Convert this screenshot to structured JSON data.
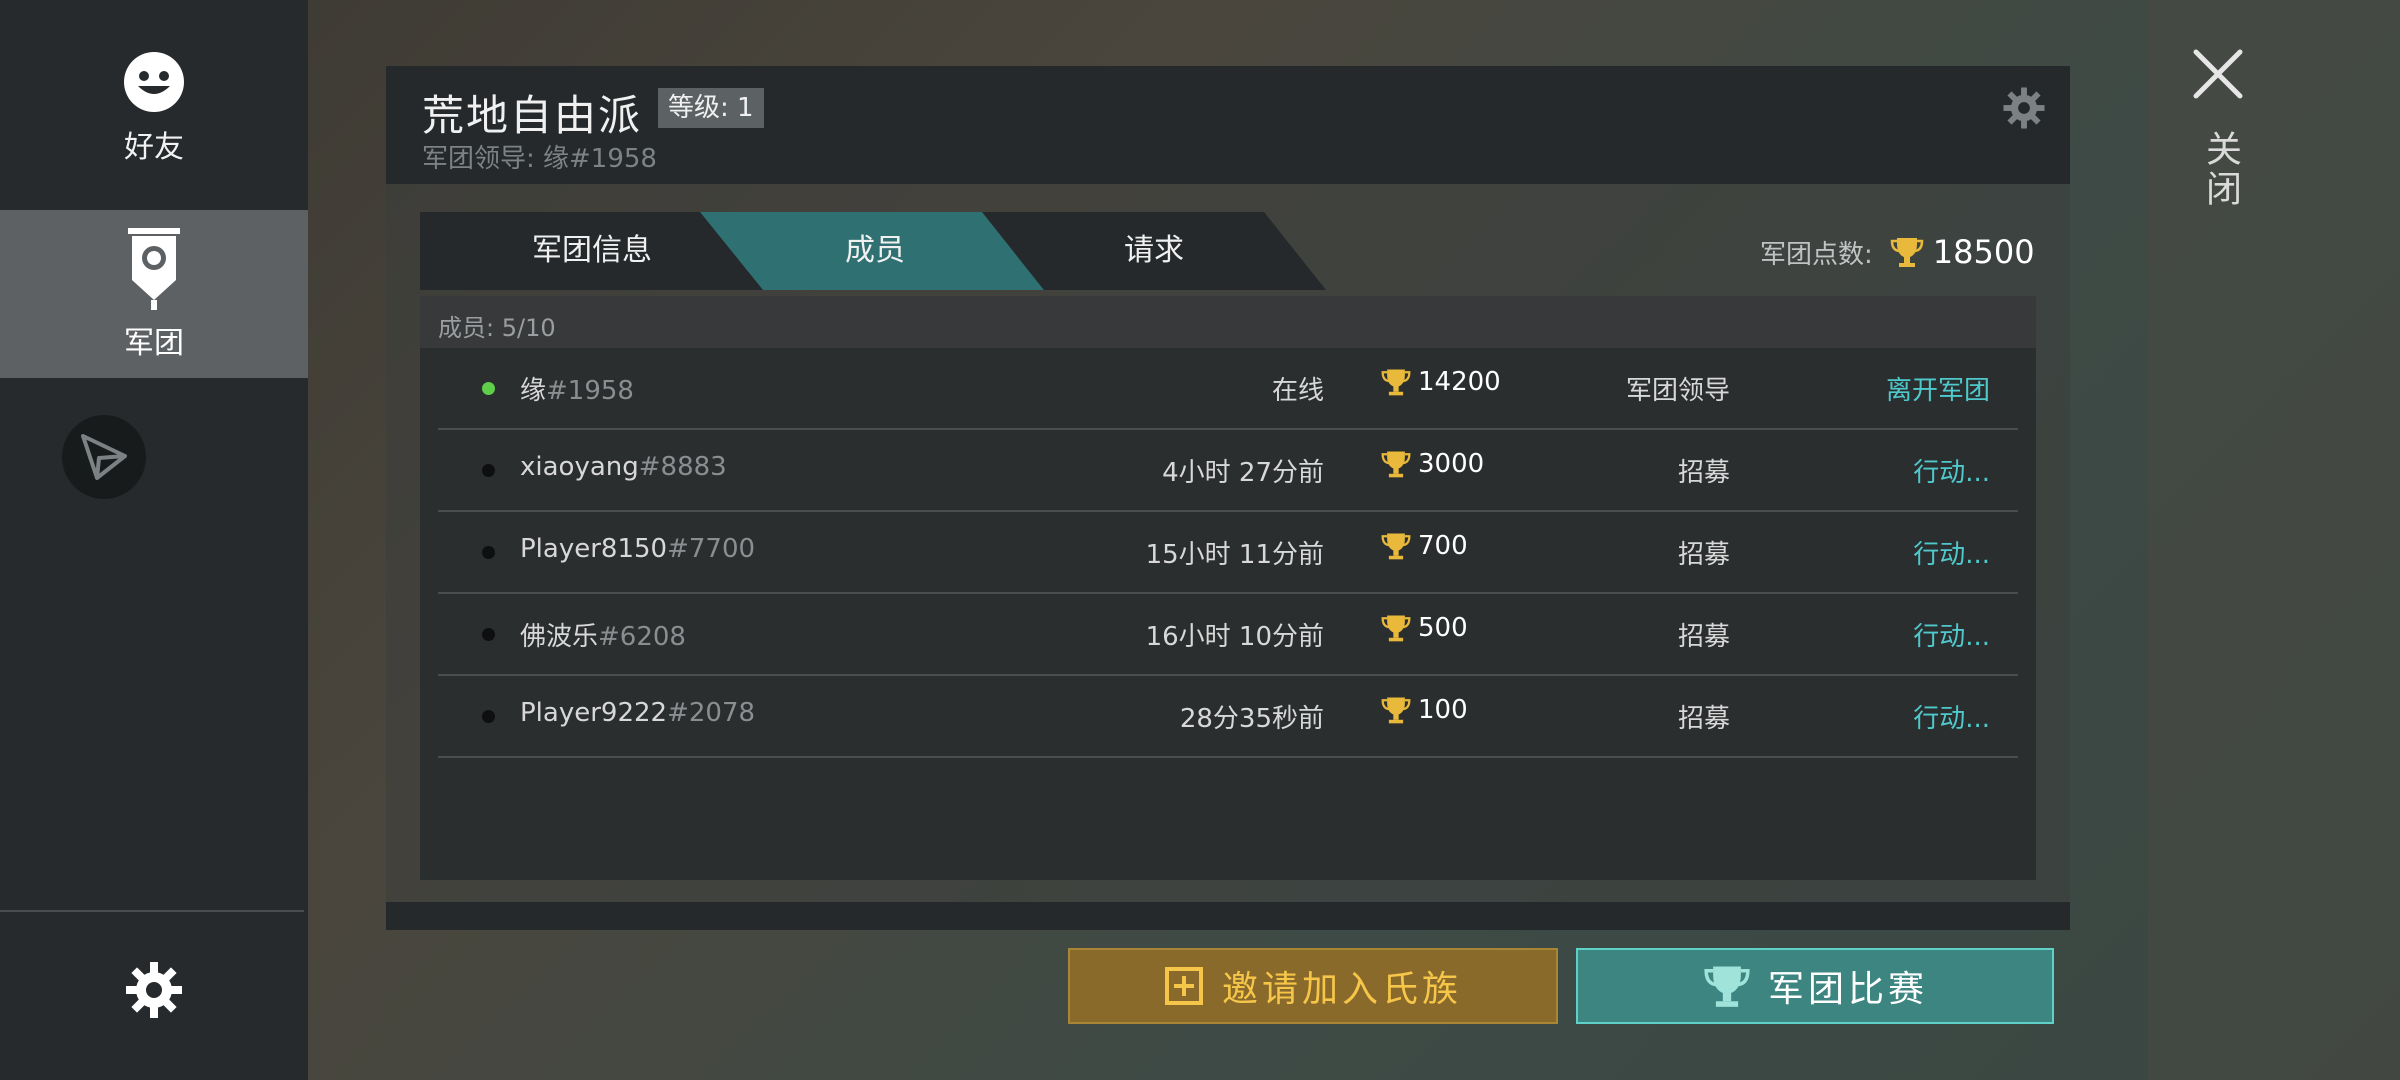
{
  "sidebar": {
    "friends_label": "好友",
    "legion_label": "军团"
  },
  "right": {
    "close_label": "关闭"
  },
  "guild": {
    "name": "荒地自由派",
    "level": "等级: 1",
    "leader_line": "军团领导: 缘#1958"
  },
  "tabs": [
    {
      "label": "军团信息"
    },
    {
      "label": "成员"
    },
    {
      "label": "请求"
    }
  ],
  "points": {
    "label": "军团点数:",
    "value": "18500"
  },
  "members": {
    "count_label": "成员: 5/10",
    "rows": [
      {
        "name": "缘",
        "tag": "#1958",
        "status": "在线",
        "trophies": "14200",
        "role": "军团领导",
        "action": "离开军团",
        "online": true
      },
      {
        "name": "xiaoyang",
        "tag": "#8883",
        "status": "4小时 27分前",
        "trophies": "3000",
        "role": "招募",
        "action": "行动...",
        "online": false
      },
      {
        "name": "Player8150",
        "tag": "#7700",
        "status": "15小时 11分前",
        "trophies": "700",
        "role": "招募",
        "action": "行动...",
        "online": false
      },
      {
        "name": "佛波乐",
        "tag": "#6208",
        "status": "16小时 10分前",
        "trophies": "500",
        "role": "招募",
        "action": "行动...",
        "online": false
      },
      {
        "name": "Player9222",
        "tag": "#2078",
        "status": "28分35秒前",
        "trophies": "100",
        "role": "招募",
        "action": "行动...",
        "online": false
      }
    ]
  },
  "buttons": {
    "invite_label": "邀请加入氏族",
    "tournament_label": "军团比赛"
  },
  "colors": {
    "accent_teal": "#2f7072",
    "action_text": "#4fc9cc",
    "trophy_gold": "#e8b93a",
    "online_green": "#5fcf4a"
  }
}
